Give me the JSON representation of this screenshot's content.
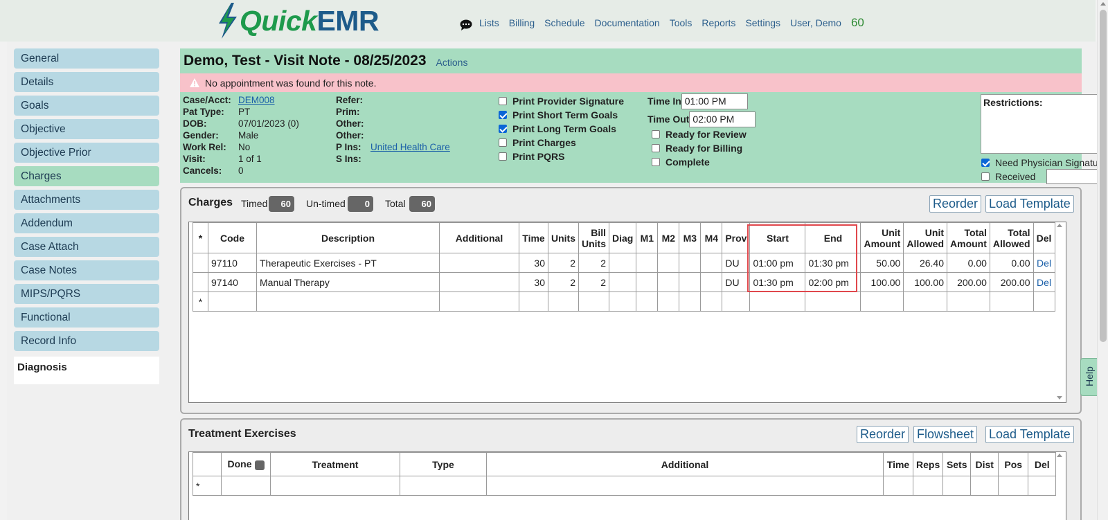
{
  "header": {
    "logo_quick": "Quick",
    "logo_emr": "EMR",
    "nav": [
      "Lists",
      "Billing",
      "Schedule",
      "Documentation",
      "Tools",
      "Reports",
      "Settings",
      "User, Demo"
    ],
    "count": "60"
  },
  "sidebar": {
    "items": [
      "General",
      "Details",
      "Goals",
      "Objective",
      "Objective Prior",
      "Charges",
      "Attachments",
      "Addendum",
      "Case Attach",
      "Case Notes",
      "MIPS/PQRS",
      "Functional",
      "Record Info"
    ],
    "active_index": 5,
    "diagnosis": "Diagnosis"
  },
  "note": {
    "title": "Demo, Test - Visit Note - 08/25/2023",
    "actions": "Actions",
    "alert": "No appointment was found for this note."
  },
  "patient": {
    "case_label": "Case/Acct:",
    "case_value": "DEM008",
    "pat_type_label": "Pat Type:",
    "pat_type_value": "PT",
    "dob_label": "DOB:",
    "dob_value": "07/01/2023 (0)",
    "gender_label": "Gender:",
    "gender_value": "Male",
    "work_rel_label": "Work Rel:",
    "work_rel_value": "No",
    "visit_label": "Visit:",
    "visit_value": "1 of 1",
    "cancels_label": "Cancels:",
    "cancels_value": "0",
    "refer_label": "Refer:",
    "prim_label": "Prim:",
    "other1_label": "Other:",
    "other2_label": "Other:",
    "pins_label": "P Ins:",
    "pins_value": "United Health Care",
    "sins_label": "S Ins:"
  },
  "print_options": [
    {
      "label": "Print Provider Signature",
      "checked": false
    },
    {
      "label": "Print Short Term Goals",
      "checked": true
    },
    {
      "label": "Print Long Term Goals",
      "checked": true
    },
    {
      "label": "Print Charges",
      "checked": false
    },
    {
      "label": "Print PQRS",
      "checked": false
    }
  ],
  "times": {
    "time_in_label": "Time In",
    "time_in_value": "01:00 PM",
    "time_out_label": "Time Out",
    "time_out_value": "02:00 PM"
  },
  "status_options": [
    {
      "label": "Ready for Review",
      "checked": false
    },
    {
      "label": "Ready for Billing",
      "checked": false
    },
    {
      "label": "Complete",
      "checked": false
    }
  ],
  "restrictions": {
    "label": "Restrictions:",
    "need_physician_label": "Need Physician Signature",
    "need_physician_checked": true,
    "received_label": "Received",
    "received_checked": false
  },
  "charges": {
    "title": "Charges",
    "timed_label": "Timed",
    "timed_value": "60",
    "untimed_label": "Un-timed",
    "untimed_value": "0",
    "total_label": "Total",
    "total_value": "60",
    "reorder": "Reorder",
    "load_template": "Load Template",
    "columns": [
      "*",
      "Code",
      "Description",
      "Additional",
      "Time",
      "Units",
      "Bill Units",
      "Diag",
      "M1",
      "M2",
      "M3",
      "M4",
      "Prov",
      "Start",
      "End",
      "Unit Amount",
      "Unit Allowed",
      "Total Amount",
      "Total Allowed",
      "Del"
    ],
    "rows": [
      {
        "code": "97110",
        "description": "Therapeutic Exercises - PT",
        "additional": "",
        "time": "30",
        "units": "2",
        "bill_units": "2",
        "prov": "DU",
        "start": "01:00 pm",
        "end": "01:30 pm",
        "unit_amount": "50.00",
        "unit_allowed": "26.40",
        "total_amount": "0.00",
        "total_allowed": "0.00",
        "del": "Del"
      },
      {
        "code": "97140",
        "description": "Manual Therapy",
        "additional": "",
        "time": "30",
        "units": "2",
        "bill_units": "2",
        "prov": "DU",
        "start": "01:30 pm",
        "end": "02:00 pm",
        "unit_amount": "100.00",
        "unit_allowed": "100.00",
        "total_amount": "200.00",
        "total_allowed": "200.00",
        "del": "Del"
      }
    ],
    "new_row_marker": "*"
  },
  "treatment": {
    "title": "Treatment Exercises",
    "reorder": "Reorder",
    "flowsheet": "Flowsheet",
    "load_template": "Load Template",
    "columns": [
      "",
      "Done",
      "Treatment",
      "Type",
      "Additional",
      "Time",
      "Reps",
      "Sets",
      "Dist",
      "Pos",
      "Del"
    ],
    "new_row_marker": "*"
  },
  "help": "Help",
  "colors": {
    "accent_green": "#a7dcc0",
    "sidebar_blue": "#b7d8e3",
    "alert_pink": "#f8c2ca",
    "highlight_red": "#e0474c"
  }
}
